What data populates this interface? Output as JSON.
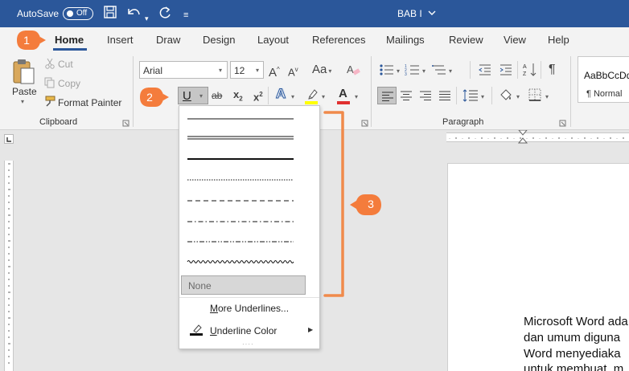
{
  "titlebar": {
    "autosave_label": "AutoSave",
    "autosave_state": "Off",
    "document_title": "BAB I",
    "background": "#2b579a",
    "quick_access_icons": [
      "save-icon",
      "undo-icon",
      "redo-icon",
      "customize-icon"
    ]
  },
  "tabs": [
    "Home",
    "Insert",
    "Draw",
    "Design",
    "Layout",
    "References",
    "Mailings",
    "Review",
    "View",
    "Help"
  ],
  "active_tab": "Home",
  "clipboard": {
    "paste": "Paste",
    "cut": "Cut",
    "copy": "Copy",
    "format_painter": "Format Painter",
    "group_label": "Clipboard"
  },
  "font": {
    "name": "Arial",
    "size": "12",
    "grow": "A",
    "shrink": "A",
    "change_case": "Aa",
    "underline": "U",
    "strikethrough": "ab",
    "subscript": "x",
    "superscript": "x",
    "text_effects": "A",
    "font_color": "A",
    "font_color_swatch": "#e03030",
    "highlight_swatch": "#ffff00"
  },
  "paragraph": {
    "group_label": "Paragraph",
    "pilcrow": "¶"
  },
  "styles": {
    "sample": "AaBbCcDd",
    "normal": "¶ Normal"
  },
  "underline_menu": {
    "styles": [
      "single",
      "double",
      "thick",
      "dotted",
      "dashed",
      "dash-dot",
      "dash-dot-dot",
      "wave"
    ],
    "none": "None",
    "more_underlines": "More Underlines...",
    "underline_color": "Underline Color"
  },
  "callouts": [
    "1",
    "2",
    "3"
  ],
  "callout_color": "#f47c3c",
  "document": {
    "lines": [
      "Microsoft Word ada",
      "dan umum diguna",
      "Word menyediaka",
      "untuk membuat, m"
    ]
  }
}
